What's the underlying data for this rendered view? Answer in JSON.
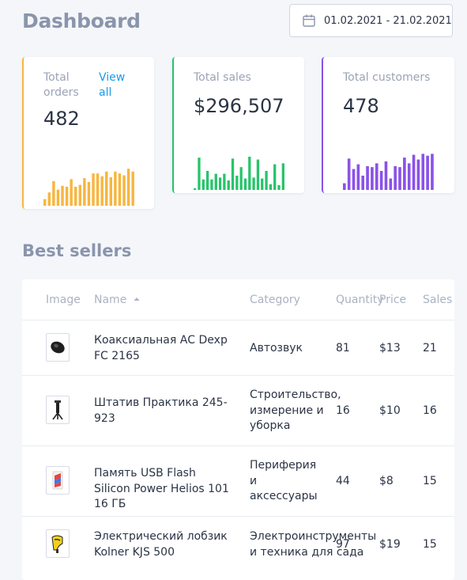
{
  "header": {
    "title": "Dashboard",
    "date_range": "01.02.2021 - 21.02.2021"
  },
  "colors": {
    "orders": "#f7b640",
    "sales": "#27c46a",
    "customers": "#8b52e8",
    "link": "#1a9be6"
  },
  "cards": {
    "orders": {
      "label": "Total orders",
      "value": "482",
      "link": "View all",
      "levels": [
        0.14,
        0.28,
        0.52,
        0.34,
        0.42,
        0.4,
        0.56,
        0.4,
        0.44,
        0.58,
        0.5,
        0.68,
        0.68,
        0.62,
        0.72,
        0.6,
        0.72,
        0.68,
        0.64,
        0.78,
        0.72
      ]
    },
    "sales": {
      "label": "Total sales",
      "value": "$296,507",
      "levels": [
        0.03,
        0.68,
        0.22,
        0.4,
        0.22,
        0.34,
        0.26,
        0.34,
        0.2,
        0.66,
        0.3,
        0.48,
        0.24,
        0.7,
        0.26,
        0.64,
        0.24,
        0.4,
        0.12,
        0.54,
        0.1,
        0.56
      ]
    },
    "customers": {
      "label": "Total customers",
      "value": "478",
      "levels": [
        0.14,
        0.66,
        0.44,
        0.54,
        0.3,
        0.5,
        0.48,
        0.56,
        0.4,
        0.6,
        0.24,
        0.5,
        0.48,
        0.68,
        0.56,
        0.74,
        0.64,
        0.76,
        0.72,
        0.76
      ]
    }
  },
  "best_sellers": {
    "title": "Best sellers",
    "columns": [
      "Image",
      "Name",
      "Category",
      "Quantity",
      "Price",
      "Sales"
    ],
    "rows": [
      {
        "name": "Коаксиальная АС Dexp FC 2165",
        "category": "Автозвук",
        "quantity": "81",
        "price": "$13",
        "sales": "21",
        "icon": "speaker-icon"
      },
      {
        "name": "Штатив Практика 245-923",
        "category": "Строительство, измерение и уборка",
        "quantity": "16",
        "price": "$10",
        "sales": "16",
        "icon": "tripod-icon"
      },
      {
        "name": "Память USB Flash Silicon Power Helios 101 16 ГБ",
        "category": "Периферия и аксессуары",
        "quantity": "44",
        "price": "$8",
        "sales": "15",
        "icon": "usb-drive-icon"
      },
      {
        "name": "Электрический лобзик Kolner KJS 500",
        "category": "Электроинструменты и техника для сада",
        "quantity": "97",
        "price": "$19",
        "sales": "15",
        "icon": "jigsaw-icon"
      }
    ]
  }
}
